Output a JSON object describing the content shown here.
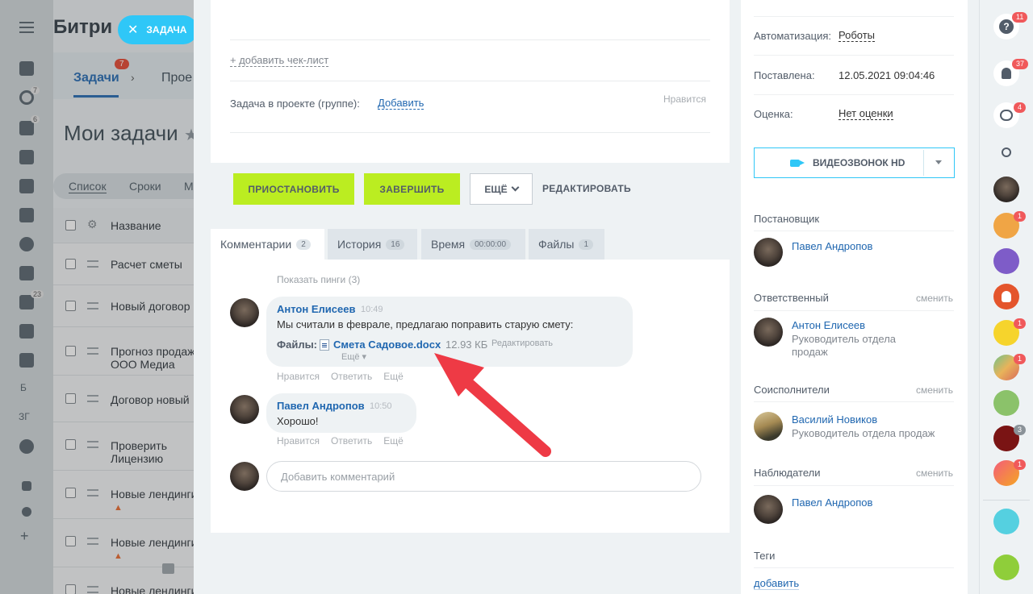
{
  "background": {
    "logo": "Битри",
    "tabs": {
      "active": "Задачи",
      "active_badge": "7",
      "next": "Прое"
    },
    "heading": "Мои задачи",
    "views": [
      "Список",
      "Сроки",
      "М"
    ],
    "table_header": "Название",
    "rows": [
      "Расчет сметы",
      "Новый договор",
      "Прогноз продаж\nООО Медиа",
      "Договор новый",
      "Проверить\nЛицензию",
      "Новые лендинги",
      "Новые лендинги",
      "Новые лендинги"
    ],
    "rail_badges": [
      "7",
      "6",
      "23"
    ],
    "rail_letters": [
      "Б",
      "ЗГ"
    ]
  },
  "task_chip": {
    "label": "ЗАДАЧА"
  },
  "task": {
    "add_checklist": "+ добавить чек-лист",
    "project_label": "Задача в проекте (группе):",
    "project_add": "Добавить",
    "likes": "Нравится"
  },
  "actions": {
    "pause": "ПРИОСТАНОВИТЬ",
    "finish": "ЗАВЕРШИТЬ",
    "more": "ЕЩЁ",
    "edit": "РЕДАКТИРОВАТЬ"
  },
  "tabs": [
    {
      "label": "Комментарии",
      "count": "2"
    },
    {
      "label": "История",
      "count": "16"
    },
    {
      "label": "Время",
      "count": "00:00:00"
    },
    {
      "label": "Файлы",
      "count": "1"
    }
  ],
  "comments": {
    "show_pings": "Показать пинги (3)",
    "items": [
      {
        "author": "Антон Елисеев",
        "time": "10:49",
        "text": "Мы считали в феврале, предлагаю поправить старую смету:",
        "files_label": "Файлы:",
        "file_name": "Смета Садовое.docx",
        "file_size": "12.93 КБ",
        "file_edit": "Редактировать",
        "file_more": "Ещё ▾"
      },
      {
        "author": "Павел Андропов",
        "time": "10:50",
        "text": "Хорошо!"
      }
    ],
    "actions": [
      "Нравится",
      "Ответить",
      "Ещё"
    ],
    "add_placeholder": "Добавить комментарий"
  },
  "info": {
    "automation_label": "Автоматизация:",
    "automation_value": "Роботы",
    "created_label": "Поставлена:",
    "created_value": "12.05.2021 09:04:46",
    "rating_label": "Оценка:",
    "rating_value": "Нет оценки",
    "video_call": "ВИДЕОЗВОНОК HD",
    "change": "сменить",
    "creator_title": "Постановщик",
    "creator_name": "Павел Андропов",
    "responsible_title": "Ответственный",
    "responsible_name": "Антон Елисеев",
    "responsible_role": "Руководитель отдела продаж",
    "coexecutors_title": "Соисполнители",
    "coexecutor_name": "Василий Новиков",
    "coexecutor_role": "Руководитель отдела продаж",
    "observers_title": "Наблюдатели",
    "observer_name": "Павел Андропов",
    "tags_title": "Теги",
    "tags_add": "добавить"
  },
  "right_bar": {
    "help_badge": "11",
    "notify_badge": "37",
    "chat_badge": "4",
    "badges": [
      "1",
      "1",
      "1",
      "3",
      "1"
    ]
  },
  "colors": {
    "accent_blue": "#2067b0",
    "green_button": "#bbed21",
    "cyan": "#2fc7f7",
    "badge_red": "#f0595b",
    "arrow_red": "#ee3a45"
  }
}
